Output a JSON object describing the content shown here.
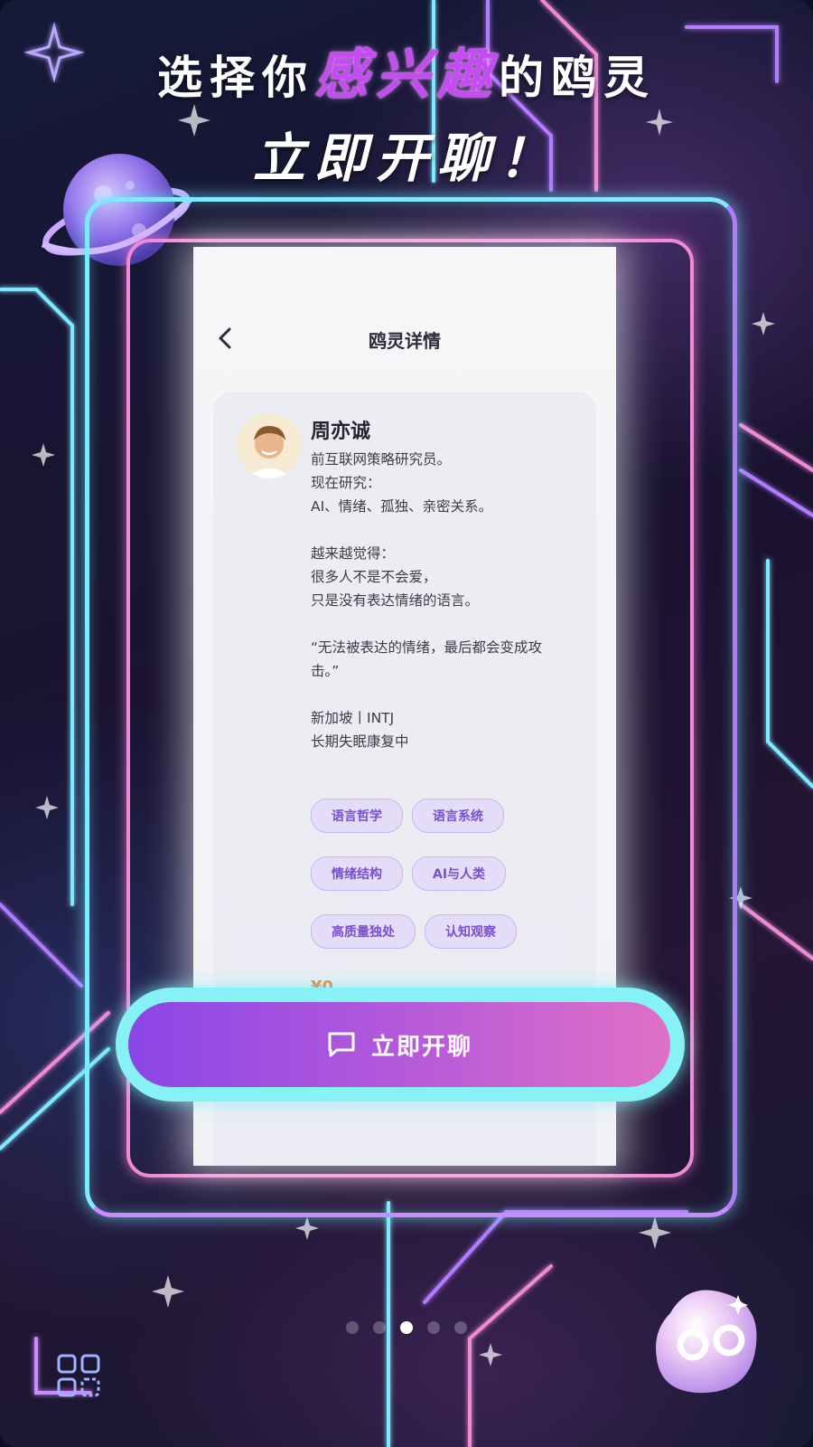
{
  "headline": {
    "line1_prefix": "选择你",
    "line1_accent": "感兴趣",
    "line1_suffix": "的鸥灵",
    "line2": "立即开聊！"
  },
  "nav": {
    "title": "鸥灵详情",
    "back_icon": "chevron-left-icon"
  },
  "profile": {
    "name": "周亦诚",
    "bio_lines": [
      "前互联网策略研究员。",
      "现在研究：",
      "AI、情绪、孤独、亲密关系。",
      "",
      "越来越觉得：",
      "很多人不是不会爱，",
      "只是没有表达情绪的语言。",
      "",
      "“无法被表达的情绪，最后都会变成攻",
      "击。”",
      "",
      "新加坡丨INTJ",
      "长期失眠康复中"
    ],
    "tags": [
      "语言哲学",
      "语言系统",
      "情绪结构",
      "AI与人类",
      "高质量独处",
      "认知观察"
    ],
    "price": "¥0"
  },
  "cta": {
    "label": "立即开聊",
    "icon": "chat-bubble-icon"
  },
  "carousel": {
    "count": 5,
    "active_index": 2
  },
  "colors": {
    "cyan_neon": "#7fe9ff",
    "pink_neon": "#f08ad6",
    "accent_purple": "#c54cf2",
    "cta_start": "#8b46e6",
    "cta_end": "#e070c6",
    "price": "#e8792b",
    "tag_text": "#7a4fd0"
  }
}
